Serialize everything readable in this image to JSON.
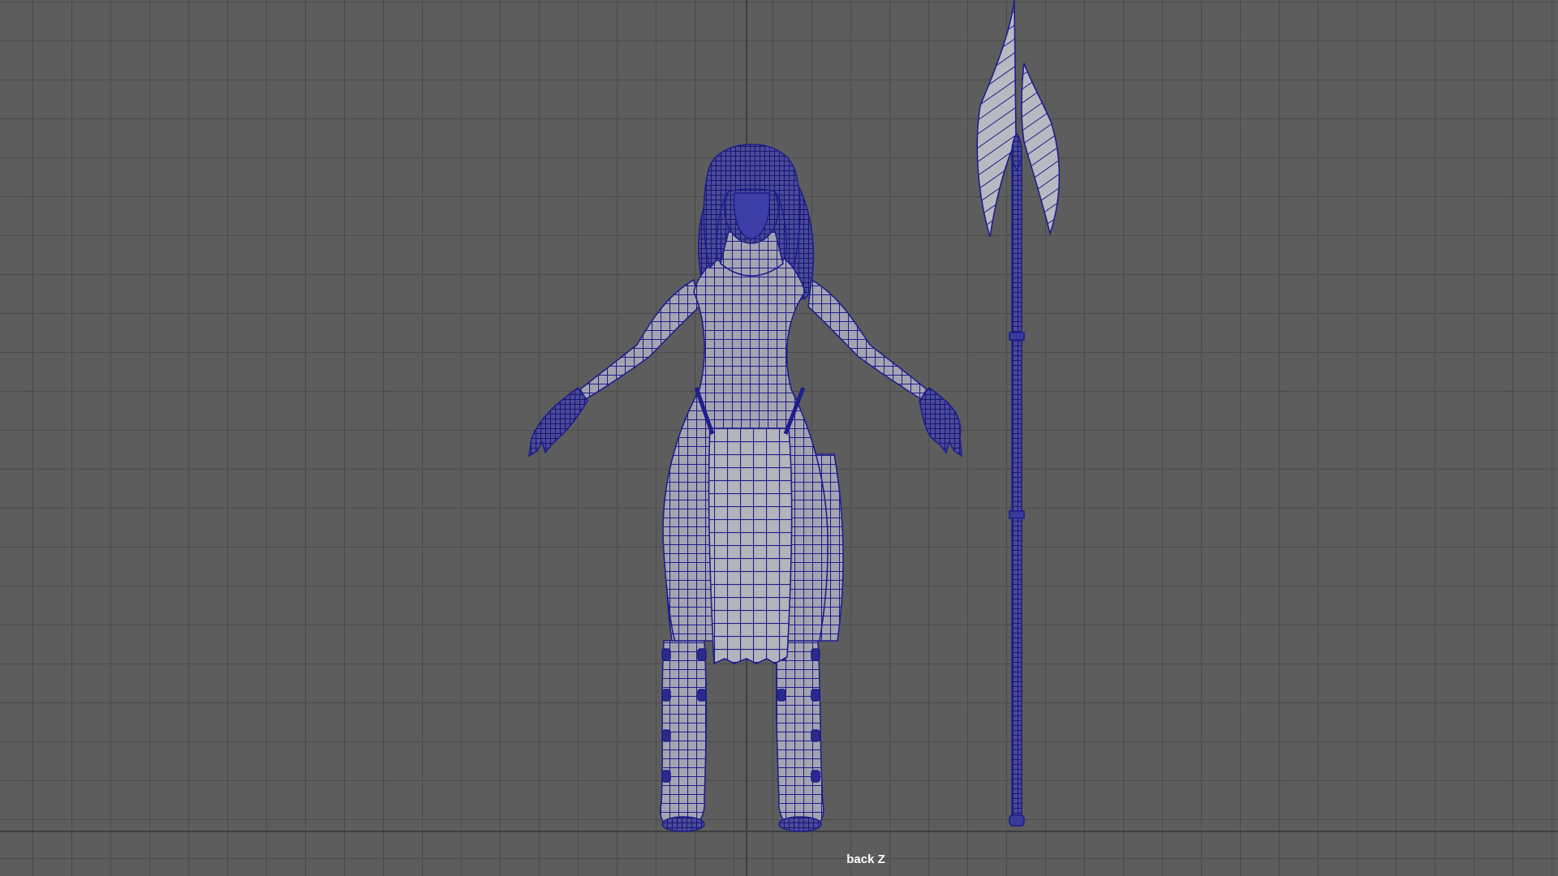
{
  "viewport": {
    "camera_label": "back Z",
    "background_color": "#5d5d5d",
    "grid_color": "#4b4b4b",
    "axis_color": "#3e3e3e",
    "wireframe_color": "#1e1e8c",
    "surface_color": "#a3a3ae"
  },
  "scene": {
    "objects": [
      {
        "name": "character-model",
        "icon": "character-wireframe",
        "display": "wireframe-on-shaded"
      },
      {
        "name": "halberd-model",
        "icon": "polearm-wireframe",
        "display": "wireframe-on-shaded"
      }
    ]
  }
}
